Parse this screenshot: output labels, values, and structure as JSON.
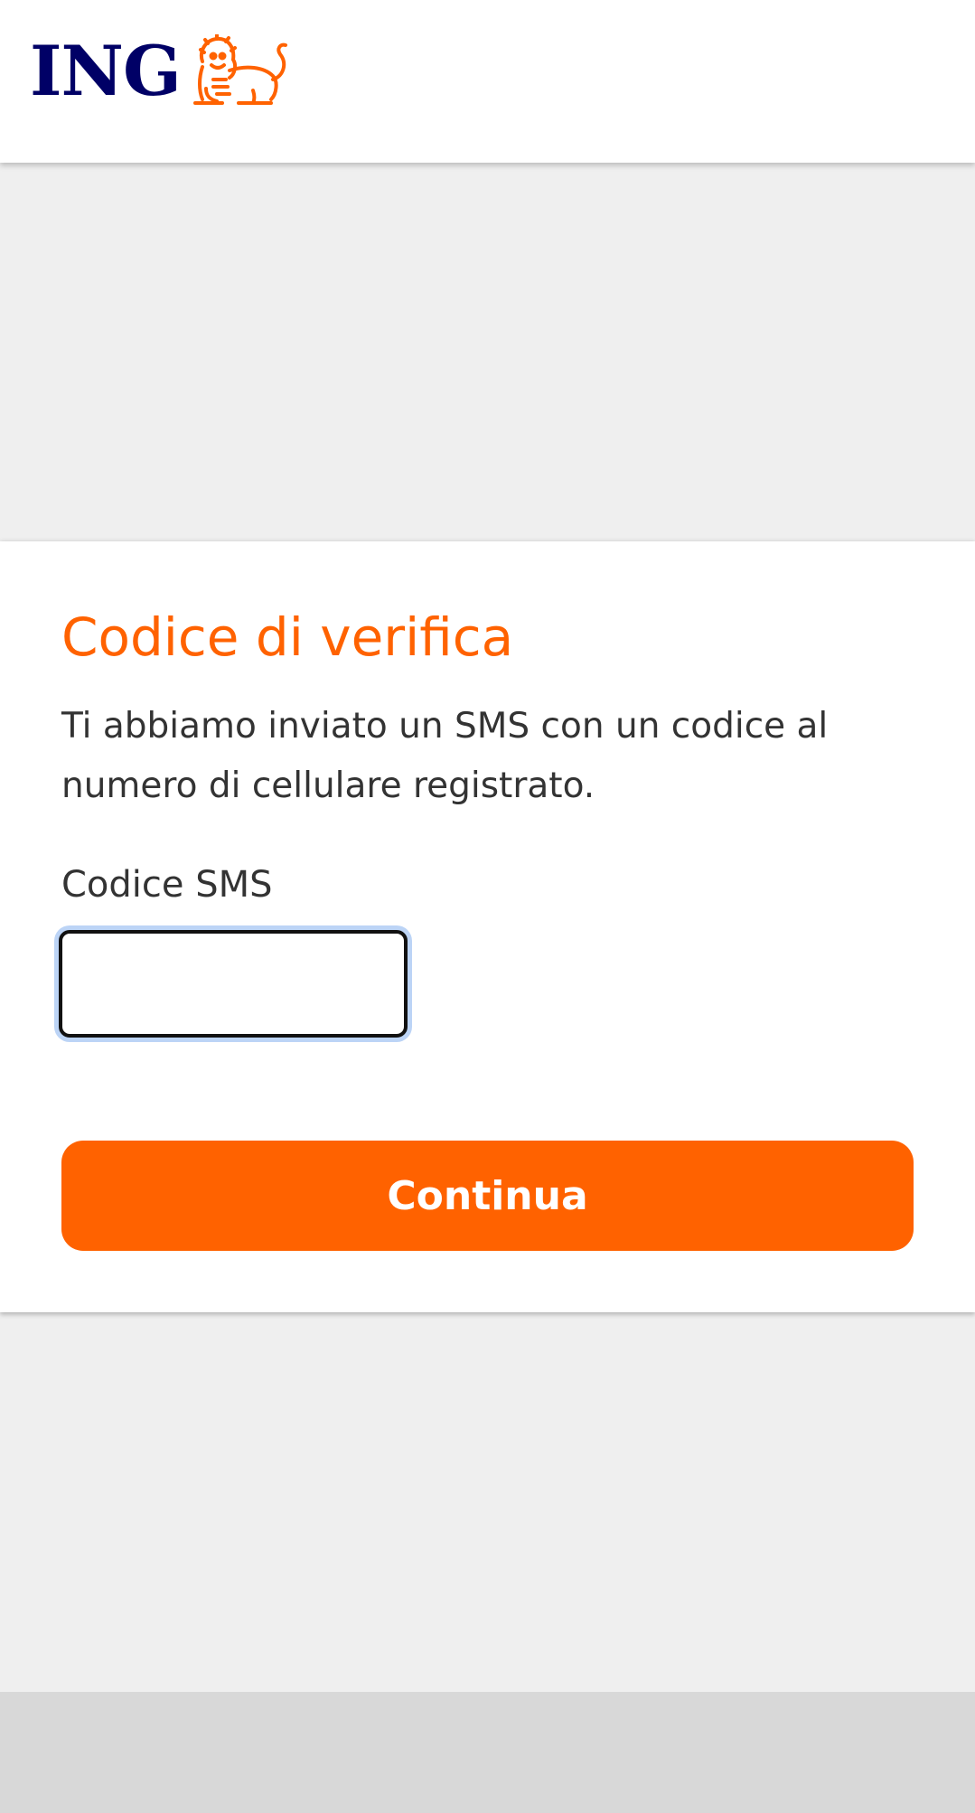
{
  "header": {
    "logo_text": "ING",
    "logo_icon": "lion-icon",
    "brand_color": "#ff6200",
    "logo_text_color": "#000066"
  },
  "verification": {
    "title": "Codice di verifica",
    "description": "Ti abbiamo inviato un SMS con un codice al numero di cellulare registrato.",
    "field_label": "Codice SMS",
    "field_value": "",
    "button_label": "Continua"
  }
}
